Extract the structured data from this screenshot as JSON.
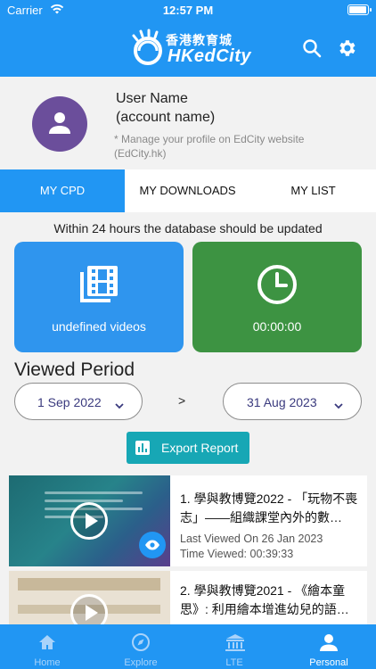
{
  "status_bar": {
    "carrier": "Carrier",
    "time": "12:57 PM",
    "battery_level": 1.0
  },
  "header": {
    "logo_cn": "香港教育城",
    "logo_en": "HKedCity",
    "icons": [
      "search-icon",
      "gear-icon"
    ]
  },
  "profile": {
    "user_name": "User Name",
    "account_name": "(account name)",
    "note": "* Manage your profile on EdCity website (EdCity.hk)"
  },
  "tabs": [
    {
      "label": "MY CPD",
      "active": true
    },
    {
      "label": "MY DOWNLOADS",
      "active": false
    },
    {
      "label": "MY LIST",
      "active": false
    }
  ],
  "notice": "Within 24 hours the database should be updated",
  "stats": {
    "videos_label": "undefined videos",
    "time_label": "00:00:00"
  },
  "period": {
    "title": "Viewed Period",
    "start": "1 Sep 2022",
    "separator": ">",
    "end": "31 Aug 2023"
  },
  "export_label": "Export Report",
  "viewed_items": [
    {
      "title": "1. 學與教博覽2022 - 「玩物不喪志」——組織課堂內外的數…",
      "last_viewed": "Last Viewed On 26 Jan 2023",
      "time_viewed": "Time Viewed: 00:39:33"
    },
    {
      "title": "2. 學與教博覽2021 - 《繪本童思》: 利用繪本增進幼兒的語…"
    }
  ],
  "bottom_nav": [
    {
      "label": "Home",
      "icon": "home-icon",
      "active": false
    },
    {
      "label": "Explore",
      "icon": "compass-icon",
      "active": false
    },
    {
      "label": "LTE",
      "icon": "building-icon",
      "active": false
    },
    {
      "label": "Personal",
      "icon": "person-icon",
      "active": true
    }
  ],
  "colors": {
    "primary_blue": "#2196f3",
    "videos_card": "#2f95ee",
    "time_card": "#3d9342",
    "avatar": "#6b4e9b",
    "export_button": "#17a7b5",
    "date_text": "#3a3a7e"
  }
}
